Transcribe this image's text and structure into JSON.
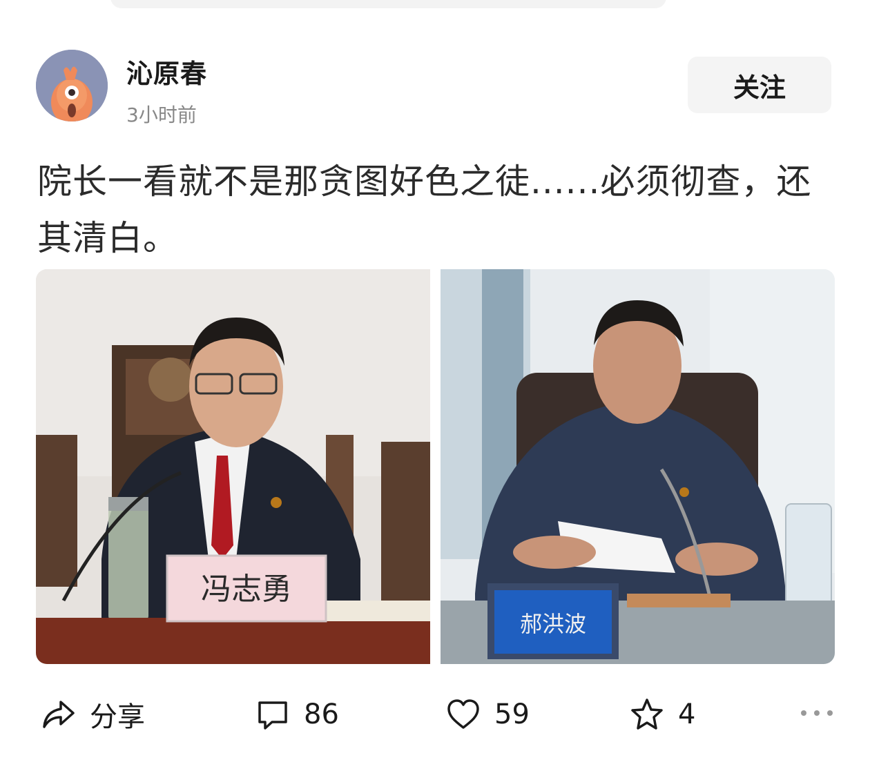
{
  "post": {
    "author": "沁原春",
    "time": "3小时前",
    "follow_label": "关注",
    "text": "院长一看就不是那贪图好色之徒......必须彻查，还其清白。"
  },
  "images": [
    {
      "nameplate": "冯志勇"
    },
    {
      "nameplate": "郝洪波"
    }
  ],
  "actions": {
    "share_label": "分享",
    "comment_count": "86",
    "like_count": "59",
    "favorite_count": "4"
  },
  "icons": {
    "share": "share-icon",
    "comment": "comment-icon",
    "like": "heart-icon",
    "favorite": "star-icon",
    "more": "more-icon"
  }
}
